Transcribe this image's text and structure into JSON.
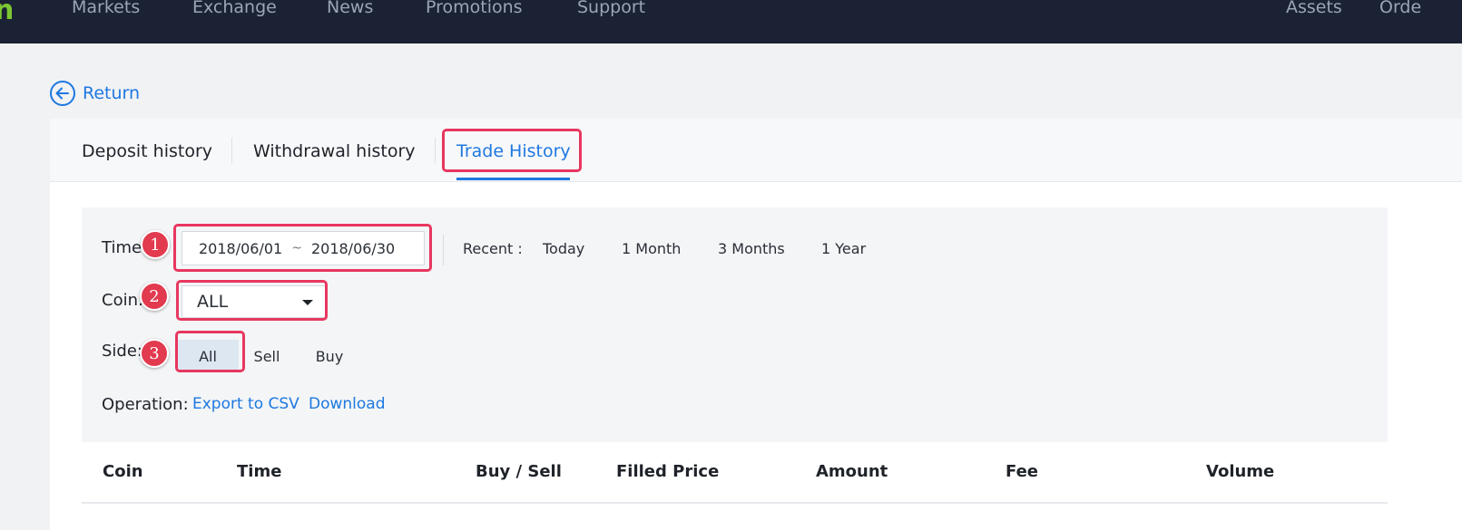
{
  "topbar": {
    "logo_fragment": "n",
    "nav": [
      "Markets",
      "Exchange",
      "News",
      "Promotions",
      "Support"
    ],
    "right_nav": [
      "Assets",
      "Orde"
    ]
  },
  "return_label": "Return",
  "tabs": [
    {
      "label": "Deposit history",
      "active": false
    },
    {
      "label": "Withdrawal history",
      "active": false
    },
    {
      "label": "Trade History",
      "active": true
    }
  ],
  "filters": {
    "time_label": "Time:",
    "date_start": "2018/06/01",
    "date_sep": "~",
    "date_end": "2018/06/30",
    "recent_label": "Recent :",
    "recent_options": [
      "Today",
      "1 Month",
      "3 Months",
      "1 Year"
    ],
    "coin_label": "Coin:",
    "coin_value": "ALL",
    "side_label": "Side:",
    "side_options": [
      "All",
      "Sell",
      "Buy"
    ],
    "side_selected": "All",
    "operation_label": "Operation:",
    "operations": [
      "Export to CSV",
      "Download"
    ]
  },
  "annotations": [
    "1",
    "2",
    "3"
  ],
  "table": {
    "columns": [
      "Coin",
      "Time",
      "Buy / Sell",
      "Filled Price",
      "Amount",
      "Fee",
      "Volume"
    ]
  },
  "colors": {
    "topbar": "#1b2233",
    "accent": "#1e78e0",
    "highlight": "#e8375f",
    "badge": "#e23a4e",
    "logo": "#7dc832"
  }
}
